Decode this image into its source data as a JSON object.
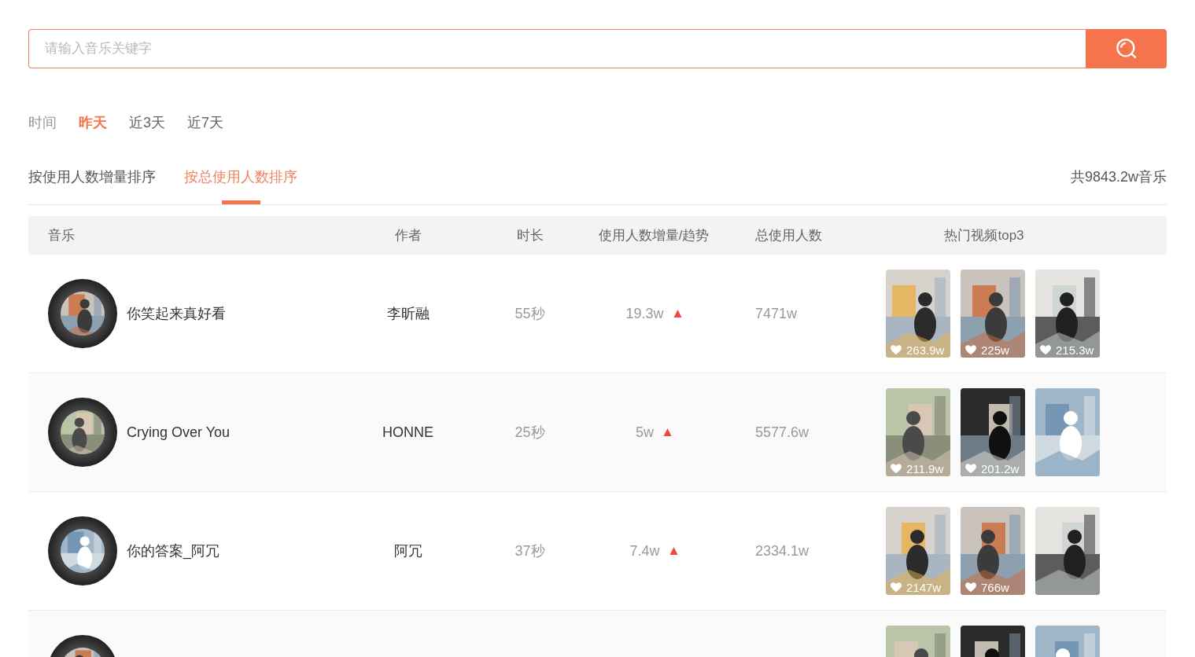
{
  "search": {
    "placeholder": "请输入音乐关键字"
  },
  "time_filter": {
    "label": "时间",
    "options": [
      {
        "label": "昨天",
        "selected": true
      },
      {
        "label": "近3天",
        "selected": false
      },
      {
        "label": "近7天",
        "selected": false
      }
    ]
  },
  "sort_tabs": [
    {
      "label": "按使用人数增量排序",
      "selected": false
    },
    {
      "label": "按总使用人数排序",
      "selected": true
    }
  ],
  "total": "共9843.2w音乐",
  "table": {
    "columns": [
      "音乐",
      "作者",
      "时长",
      "使用人数增量/趋势",
      "总使用人数",
      "热门视频top3"
    ],
    "rows": [
      {
        "name": "你笑起来真好看",
        "author": "李昕融",
        "duration": "55秒",
        "growth": "19.3w",
        "rising": true,
        "total": "7471w",
        "videos": [
          {
            "kind": "liked",
            "likes": "263.9w"
          },
          {
            "kind": "liked",
            "likes": "225w"
          },
          {
            "kind": "liked",
            "likes": "215.3w"
          }
        ]
      },
      {
        "name": "Crying Over You",
        "author": "HONNE",
        "duration": "25秒",
        "growth": "5w",
        "rising": true,
        "total": "5577.6w",
        "videos": [
          {
            "kind": "liked",
            "likes": "211.9w"
          },
          {
            "kind": "liked",
            "likes": "201.2w"
          },
          {
            "kind": "plain"
          }
        ]
      },
      {
        "name": "你的答案_阿冗",
        "author": "阿冗",
        "duration": "37秒",
        "growth": "7.4w",
        "rising": true,
        "total": "2334.1w",
        "videos": [
          {
            "kind": "liked",
            "likes": "2147w"
          },
          {
            "kind": "liked",
            "likes": "766w"
          },
          {
            "kind": "plain"
          }
        ]
      },
      {
        "videos": [
          {
            "kind": "plain"
          },
          {
            "kind": "plain"
          },
          {
            "kind": "plain"
          }
        ]
      }
    ]
  }
}
